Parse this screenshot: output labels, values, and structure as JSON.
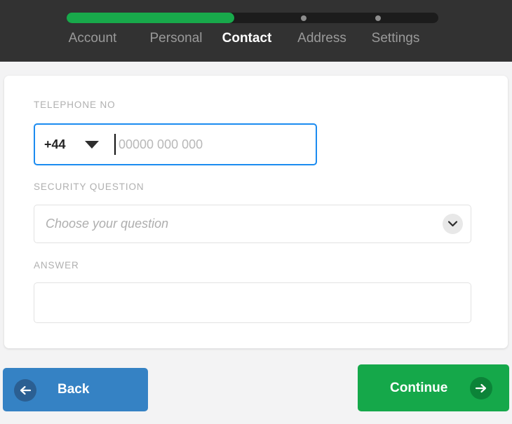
{
  "stepper": {
    "progress_percent": 45,
    "track_color": "#1c1c1c",
    "fill_color": "#18a94b",
    "dot_color": "#8d8d8d",
    "steps": [
      {
        "label": "Account",
        "state": "complete"
      },
      {
        "label": "Personal",
        "state": "complete"
      },
      {
        "label": "Contact",
        "state": "current"
      },
      {
        "label": "Address",
        "state": "upcoming"
      },
      {
        "label": "Settings",
        "state": "upcoming"
      }
    ],
    "dots": [
      {
        "left_percent": 63
      },
      {
        "left_percent": 83
      }
    ]
  },
  "form": {
    "telephone": {
      "label": "TELEPHONE NO",
      "country_code": "+44",
      "dropdown_icon": "triangle-down-icon",
      "placeholder": "00000 000 000",
      "value": "",
      "focused": true,
      "focus_border_color": "#1b8bf0"
    },
    "security_question": {
      "label": "SECURITY QUESTION",
      "placeholder": "Choose your question",
      "value": "",
      "chevron_icon": "chevron-down-icon"
    },
    "answer": {
      "label": "ANSWER",
      "placeholder": "",
      "value": ""
    }
  },
  "footer": {
    "back": {
      "label": "Back",
      "icon": "arrow-left-icon",
      "color": "#3582c4"
    },
    "continue": {
      "label": "Continue",
      "icon": "arrow-right-icon",
      "color": "#15a84a"
    }
  }
}
